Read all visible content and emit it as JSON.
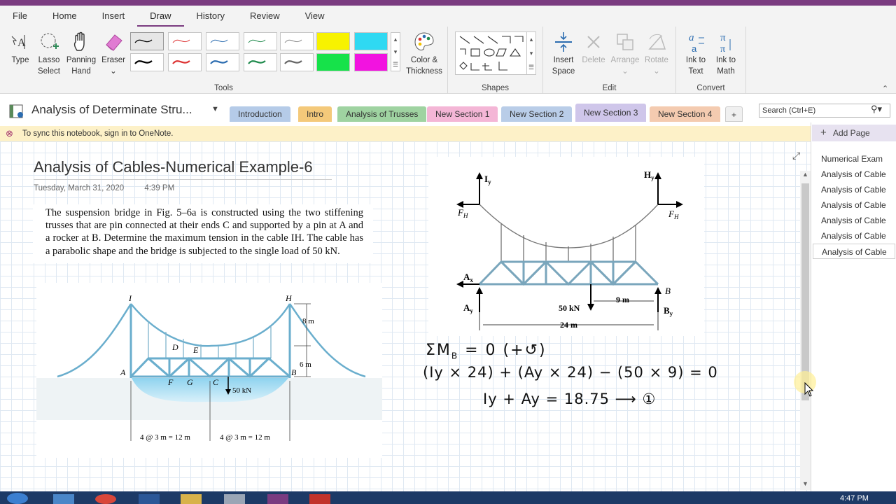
{
  "menu": {
    "items": [
      "File",
      "Home",
      "Insert",
      "Draw",
      "History",
      "Review",
      "View"
    ]
  },
  "tools": {
    "type": "Type",
    "lasso_a": "Lasso",
    "lasso_b": "Select",
    "pan_a": "Panning",
    "pan_b": "Hand",
    "eraser": "Eraser",
    "color_a": "Color &",
    "color_b": "Thickness",
    "group": "Tools"
  },
  "shapes": {
    "group": "Shapes"
  },
  "edit": {
    "insert_a": "Insert",
    "insert_b": "Space",
    "delete": "Delete",
    "arrange": "Arrange",
    "rotate": "Rotate",
    "group": "Edit"
  },
  "convert": {
    "ink_text_a": "Ink to",
    "ink_text_b": "Text",
    "ink_math_a": "Ink to",
    "ink_math_b": "Math",
    "group": "Convert"
  },
  "notebook": {
    "title": "Analysis of Determinate Stru..."
  },
  "tabs": [
    "Introduction",
    "Intro",
    "Analysis of Trusses",
    "New Section 1",
    "New Section 2",
    "New Section 3",
    "New Section 4"
  ],
  "tab_colors": [
    "#b5cbe8",
    "#f4c97a",
    "#9fd3a1",
    "#f4b6d6",
    "#b9cde8",
    "#cfc6ea",
    "#f4cbb0"
  ],
  "search": {
    "placeholder": "Search (Ctrl+E)"
  },
  "sync": {
    "message": "To sync this notebook, sign in to OneNote."
  },
  "page": {
    "title": "Analysis of Cables-Numerical Example-6",
    "date": "Tuesday, March 31, 2020",
    "time": "4:39 PM"
  },
  "problem": {
    "text": "The suspension bridge in Fig. 5–6a is constructed using the two stiffening trusses that are pin connected at their ends C and supported by a pin at A and a rocker at B. Determine the maximum tension in the cable IH. The cable has a parabolic shape and the bridge is subjected to the single load of 50 kN."
  },
  "figure1": {
    "I": "I",
    "H": "H",
    "D": "D",
    "E": "E",
    "A": "A",
    "F": "F",
    "G": "G",
    "C": "C",
    "B": "B",
    "load": "50 kN",
    "h1": "8 m",
    "h2": "6 m",
    "span1": "4 @ 3 m = 12 m",
    "span2": "4 @ 3 m = 12 m"
  },
  "figure2": {
    "Iy": "I",
    "Iy_sub": "y",
    "Hy": "H",
    "Hy_sub": "y",
    "FH_left": "F",
    "FH_right": "F",
    "FH_sub": "H",
    "Ax": "A",
    "Ax_sub": "x",
    "Ay": "A",
    "Ay_sub": "y",
    "B": "B",
    "By": "B",
    "By_sub": "y",
    "load": "50 kN",
    "dist": "9 m",
    "span": "24 m"
  },
  "handwriting": {
    "line1": "ΣM",
    "line1_sub": "B",
    "line1_rest": "= 0  (+↺)",
    "line2": "(Iy × 24) + (Ay × 24) − (50 × 9) = 0",
    "line3": "Iy + Ay = 18.75 ⟶ ①"
  },
  "pages": {
    "add": "Add Page",
    "items": [
      "Numerical Exam",
      "Analysis of Cable",
      "Analysis of Cable",
      "Analysis of Cable",
      "Analysis of Cable",
      "Analysis of Cable",
      "Analysis of Cable"
    ]
  },
  "clock": "4:47 PM"
}
